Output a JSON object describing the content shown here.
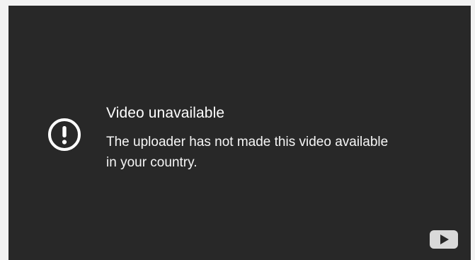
{
  "error": {
    "title": "Video unavailable",
    "message": "The uploader has not made this video available in your country.",
    "icon": "exclamation-circle-icon"
  },
  "player": {
    "background_color": "#282828",
    "logo_icon": "youtube-logo-icon"
  }
}
